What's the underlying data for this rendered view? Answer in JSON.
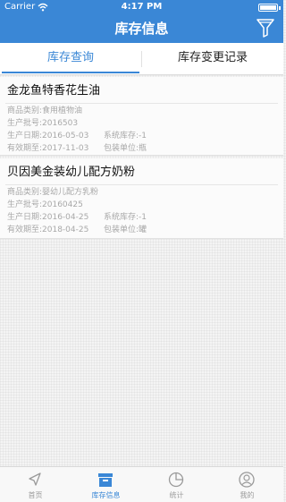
{
  "status_bar": {
    "carrier": "Carrier",
    "time": "4:17 PM",
    "wifi_icon": "wifi-icon",
    "battery_icon": "battery-icon"
  },
  "header": {
    "title": "库存信息",
    "filter_icon": "funnel-filter-icon",
    "background_color": "#3a87d6"
  },
  "tabs": [
    {
      "label": "库存查询",
      "active": true
    },
    {
      "label": "库存变更记录",
      "active": false
    }
  ],
  "items": [
    {
      "name": "金龙鱼特香花生油",
      "category": "商品类别:食用植物油",
      "batch": "生产批号:2016503",
      "production_date": "生产日期:2016-05-03",
      "system_stock": "系统库存:-1",
      "expiry_date": "有效期至:2017-11-03",
      "unit": "包装单位:瓶"
    },
    {
      "name": "贝因美金装幼儿配方奶粉",
      "category": "商品类别:婴幼儿配方乳粉",
      "batch": "生产批号:20160425",
      "production_date": "生产日期:2016-04-25",
      "system_stock": "系统库存:-1",
      "expiry_date": "有效期至:2018-04-25",
      "unit": "包装单位:罐"
    }
  ],
  "tabbar": [
    {
      "label": "首页",
      "icon": "paper-plane-icon",
      "active": false
    },
    {
      "label": "库存信息",
      "icon": "inventory-box-icon",
      "active": true
    },
    {
      "label": "统计",
      "icon": "pie-chart-icon",
      "active": false
    },
    {
      "label": "我的",
      "icon": "user-profile-icon",
      "active": false
    }
  ],
  "colors": {
    "accent": "#3a87d6",
    "inactive": "#9a9a9a"
  }
}
